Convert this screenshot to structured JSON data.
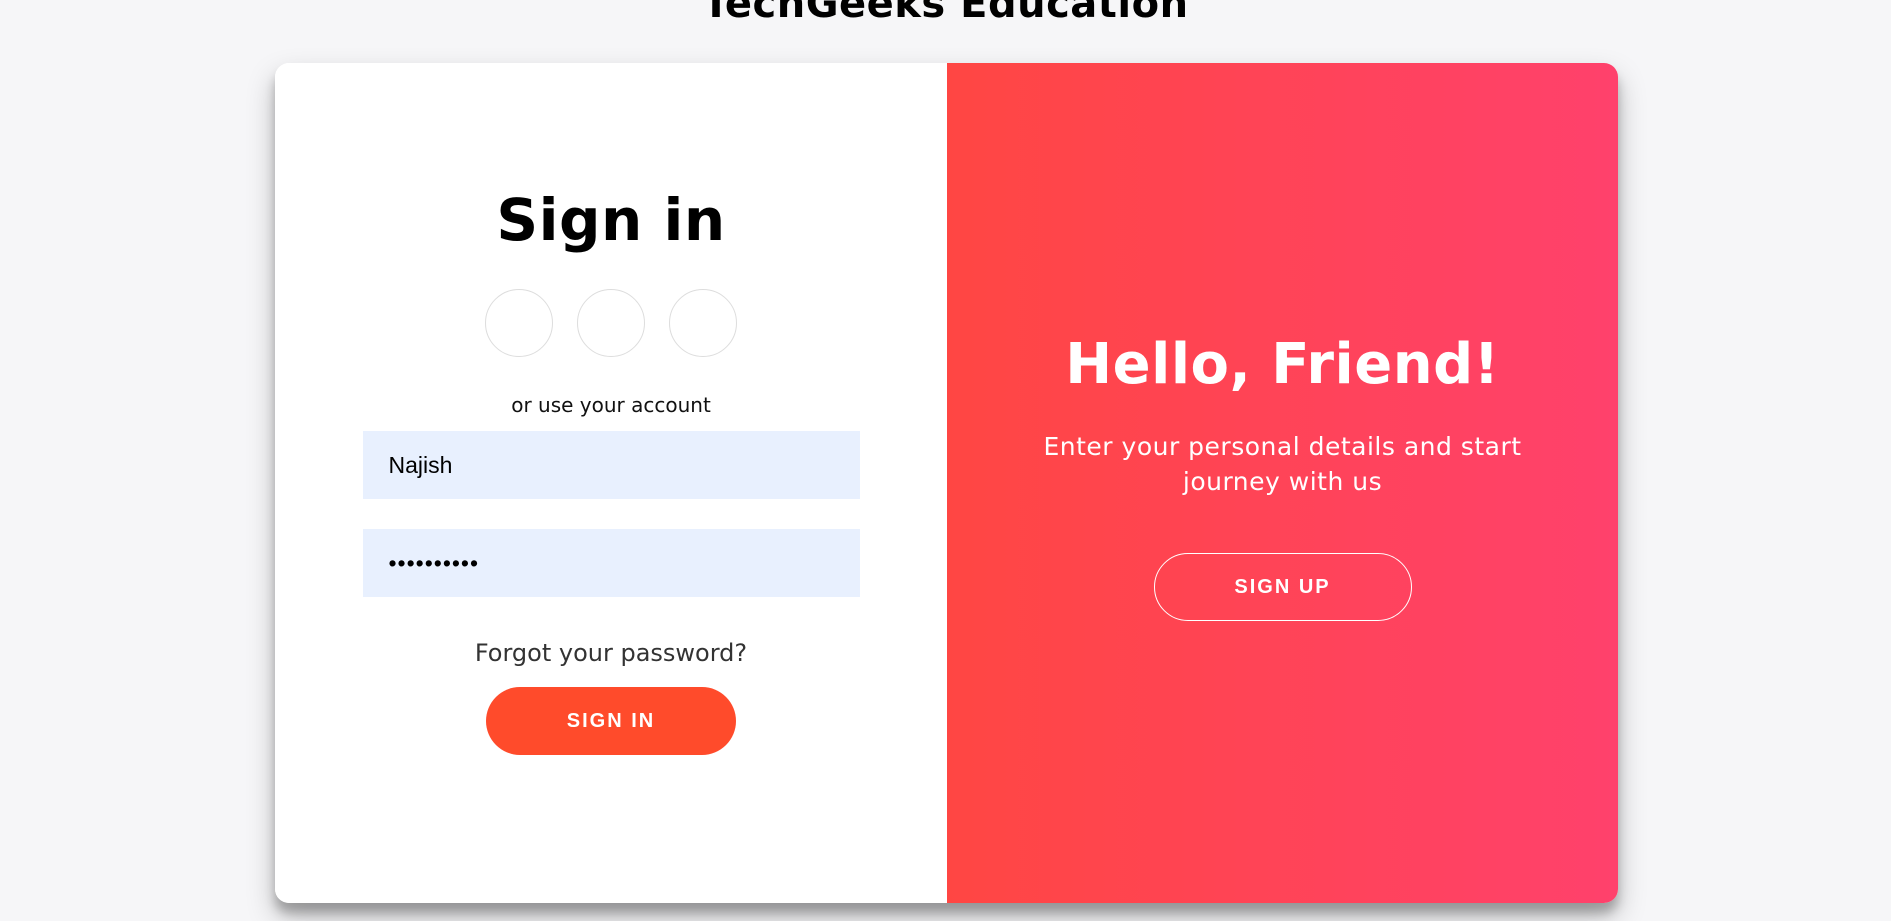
{
  "header": {
    "title": "TechGeeks Education"
  },
  "signin": {
    "title": "Sign in",
    "social_buttons": [
      "facebook-icon",
      "google-icon",
      "linkedin-icon"
    ],
    "alt_text": "or use your account",
    "username_value": "Najish",
    "password_value": "••••••••••",
    "forgot_label": "Forgot your password?",
    "button_label": "SIGN IN"
  },
  "overlay": {
    "title": "Hello, Friend!",
    "text": "Enter your personal details and start journey with us",
    "button_label": "SIGN UP"
  },
  "colors": {
    "background": "#f6f6f8",
    "accent": "#ff4b2b",
    "gradient_start": "#ff4643",
    "gradient_end": "#ff416c",
    "input_background": "#e8f0fe"
  }
}
